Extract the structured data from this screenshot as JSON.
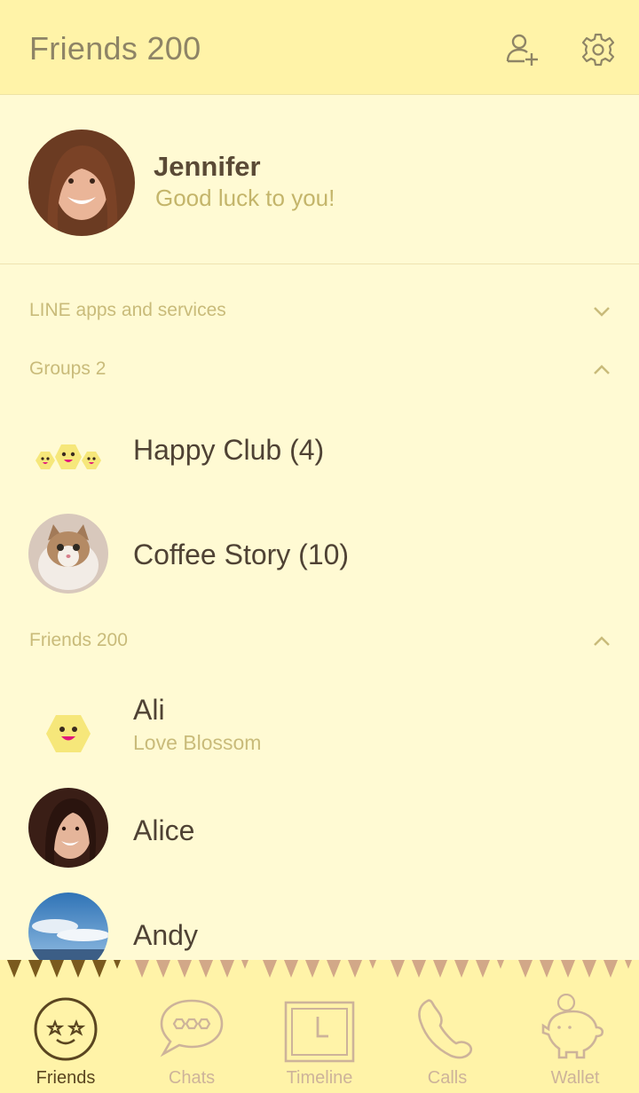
{
  "header": {
    "title": "Friends 200",
    "add_friend_icon": "add-friend-icon",
    "settings_icon": "gear-icon"
  },
  "profile": {
    "name": "Jennifer",
    "status": "Good luck to you!"
  },
  "sections": [
    {
      "label": "LINE apps and services",
      "state": "collapsed"
    },
    {
      "label": "Groups 2",
      "state": "expanded"
    },
    {
      "label": "Friends 200",
      "state": "expanded"
    }
  ],
  "groups": [
    {
      "name": "Happy Club (4)"
    },
    {
      "name": "Coffee Story (10)"
    }
  ],
  "friends": [
    {
      "name": "Ali",
      "status": "Love Blossom"
    },
    {
      "name": "Alice"
    },
    {
      "name": "Andy"
    }
  ],
  "tabs": [
    {
      "label": "Friends",
      "active": true,
      "icon": "friends-icon"
    },
    {
      "label": "Chats",
      "icon": "chat-bubble-icon"
    },
    {
      "label": "Timeline",
      "icon": "clock-icon"
    },
    {
      "label": "Calls",
      "icon": "phone-icon"
    },
    {
      "label": "Wallet",
      "icon": "piggy-bank-icon"
    }
  ],
  "colors": {
    "background": "#fffad3",
    "header": "#fff3a8",
    "text_dark": "#4f4234",
    "text_muted": "#c9bb7a",
    "tab_inactive": "#cdb39a",
    "tab_active": "#5a4520"
  }
}
